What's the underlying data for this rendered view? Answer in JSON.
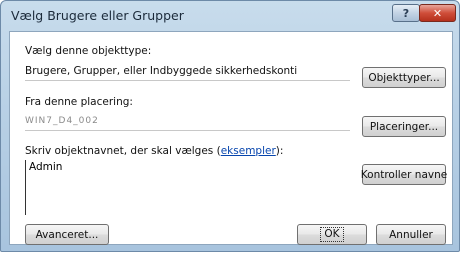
{
  "window": {
    "title": "Vælg Brugere eller Grupper",
    "help_label": "?",
    "close_label": "✕"
  },
  "object_type": {
    "label": "Vælg denne objekttype:",
    "value": "Brugere, Grupper, eller Indbyggede sikkerhedskonti",
    "button": "Objekttyper..."
  },
  "location": {
    "label": "Fra denne placering:",
    "value": "WIN7_D4_002",
    "button": "Placeringer..."
  },
  "names": {
    "label_pre": "Skriv objektnavnet, der skal vælges (",
    "label_link": "eksempler",
    "label_post": "):",
    "value": "Admin",
    "check_button": "Kontroller navne"
  },
  "footer": {
    "advanced_button": "Avanceret...",
    "ok_button": "OK",
    "cancel_button": "Annuller"
  },
  "colors": {
    "link": "#0645ad",
    "close": "#cf4e3a"
  }
}
